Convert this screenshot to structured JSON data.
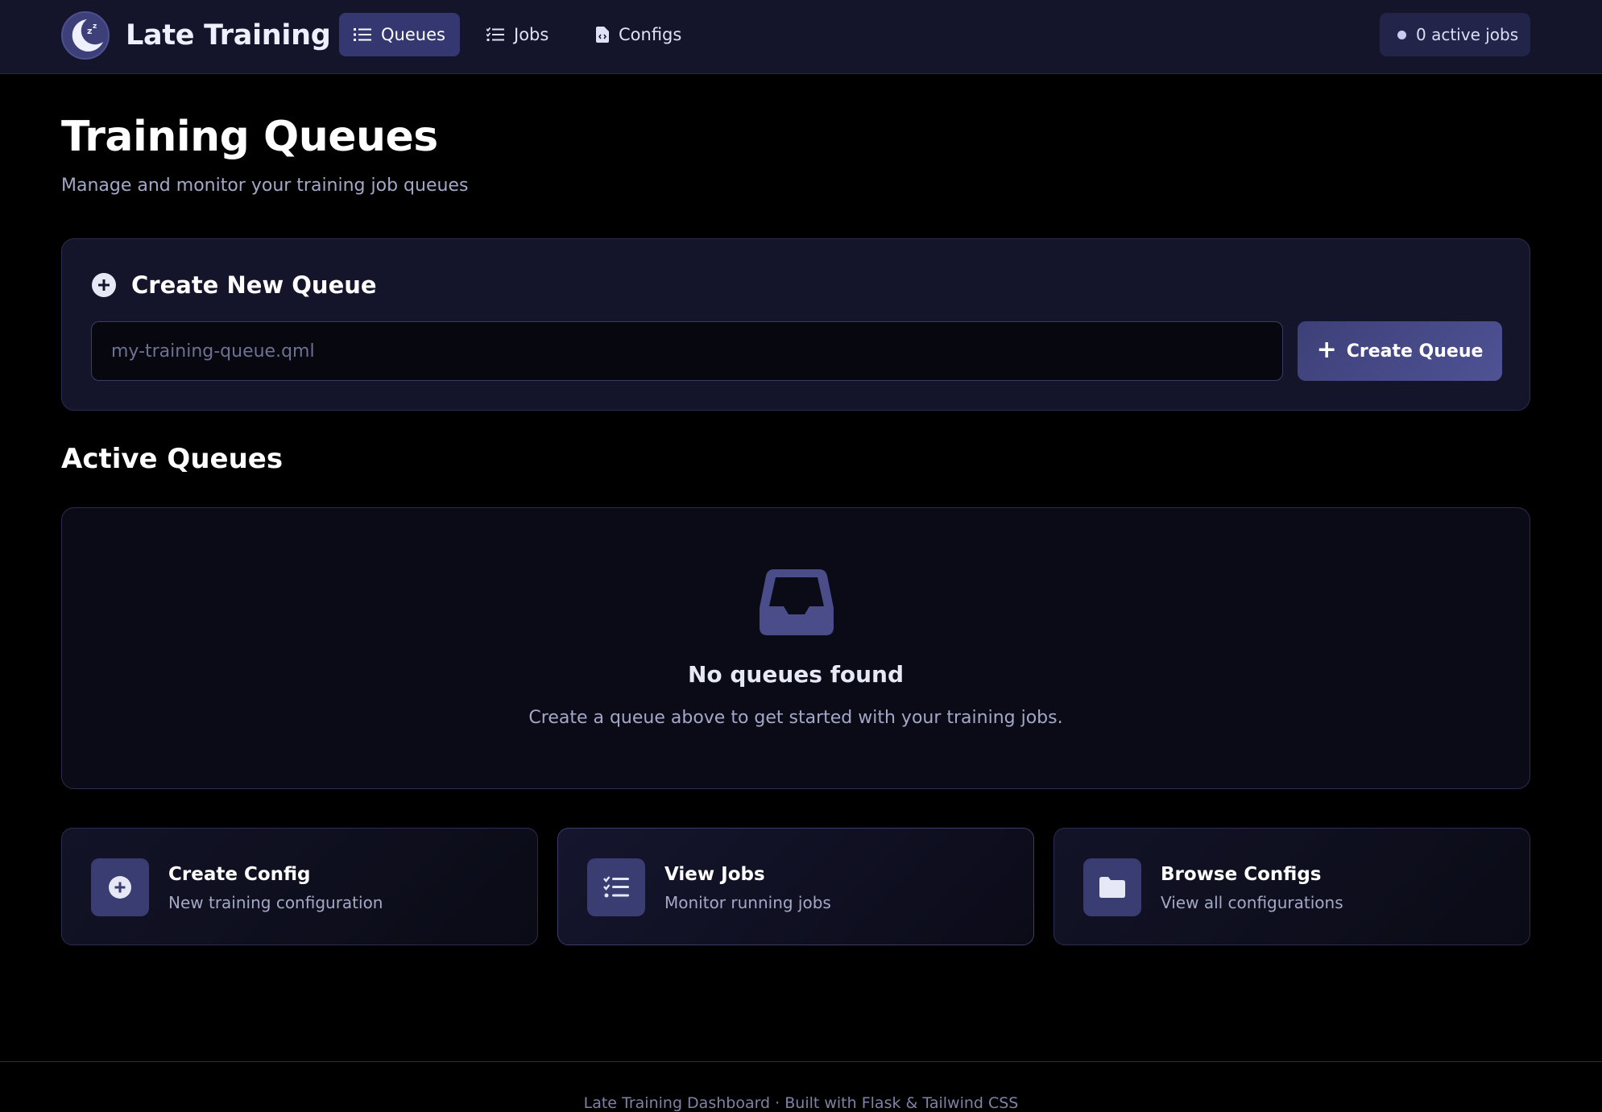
{
  "brand": {
    "title": "Late Training",
    "logo_icon": "moon-sleep-icon"
  },
  "nav": {
    "items": [
      {
        "label": "Queues",
        "icon": "list-icon",
        "active": true
      },
      {
        "label": "Jobs",
        "icon": "checklist-icon",
        "active": false
      },
      {
        "label": "Configs",
        "icon": "file-code-icon",
        "active": false
      }
    ]
  },
  "status": {
    "text": "0 active jobs"
  },
  "page": {
    "title": "Training Queues",
    "subtitle": "Manage and monitor your training job queues"
  },
  "create_queue": {
    "title": "Create New Queue",
    "icon": "plus-circle-icon",
    "input_placeholder": "my-training-queue.qml",
    "input_value": "",
    "button_label": "Create Queue",
    "button_icon": "plus-icon"
  },
  "active_queues": {
    "title": "Active Queues",
    "empty_icon": "inbox-icon",
    "empty_title": "No queues found",
    "empty_text": "Create a queue above to get started with your training jobs."
  },
  "quick_actions": [
    {
      "title": "Create Config",
      "subtitle": "New training configuration",
      "icon": "plus-circle-icon"
    },
    {
      "title": "View Jobs",
      "subtitle": "Monitor running jobs",
      "icon": "checklist-icon"
    },
    {
      "title": "Browse Configs",
      "subtitle": "View all configurations",
      "icon": "folder-icon"
    }
  ],
  "footer": {
    "text": "Late Training Dashboard · Built with Flask & Tailwind CSS"
  },
  "colors": {
    "background": "#000000",
    "navbar": "#14142a",
    "card": "#14142a",
    "accent": "#3d4078",
    "text_muted": "#a3a8c6"
  }
}
